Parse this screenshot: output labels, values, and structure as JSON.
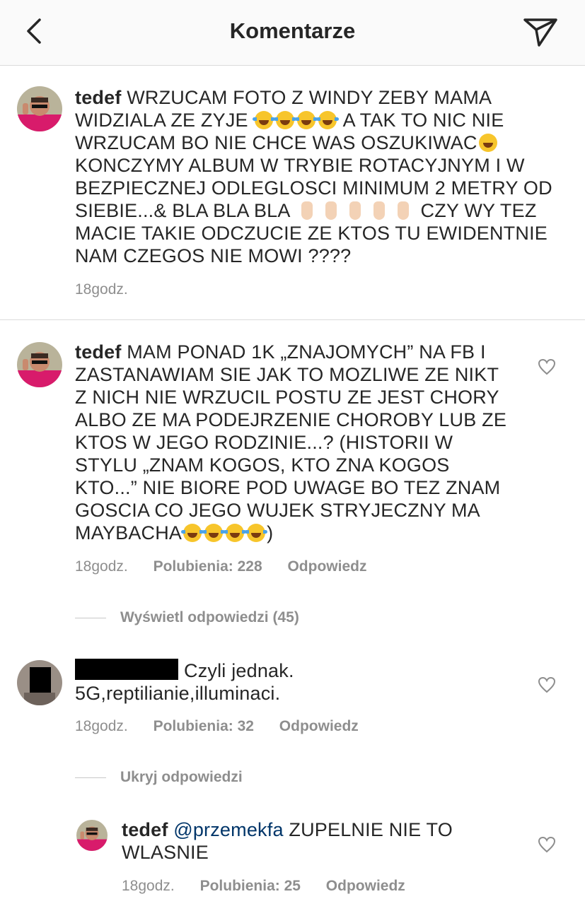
{
  "header": {
    "title": "Komentarze"
  },
  "comments": [
    {
      "user": "tedef",
      "lines": [
        "WRZUCAM FOTO Z WINDY ZEBY MAMA",
        "WIDZIALA ZE ZYJE",
        "A TAK TO NIC NIE",
        "WRZUCAM BO NIE CHCE WAS OSZUKIWAC",
        "KONCZYMY ALBUM W TRYBIE ROTACYJNYM I W",
        "BEZPIECZNEJ ODLEGLOSCI MINIMUM 2 METRY OD",
        "SIEBIE...& BLA BLA BLA",
        "CZY WY TEZ",
        "MACIE TAKIE ODCZUCIE ZE KTOS TU EWIDENTNIE",
        "NAM CZEGOS NIE MOWI ????"
      ],
      "time": "18godz."
    },
    {
      "user": "tedef",
      "lines": [
        "MAM PONAD 1K „ZNAJOMYCH” NA FB I",
        "ZASTANAWIAM SIE JAK TO MOZLIWE ZE NIKT",
        "Z NICH NIE WRZUCIL POSTU ZE JEST CHORY",
        "ALBO ZE MA PODEJRZENIE CHOROBY LUB ZE",
        "KTOS W JEGO RODZINIE...? (HISTORII W",
        "STYLU „ZNAM KOGOS, KTO ZNA KOGOS",
        "KTO...” NIE BIORE POD UWAGE BO TEZ ZNAM",
        "GOSCIA CO JEGO WUJEK STRYJECZNY MA",
        "MAYBACHA",
        ")"
      ],
      "time": "18godz.",
      "likes": "Polubienia: 228",
      "reply": "Odpowiedz",
      "view_replies": "Wyświetl odpowiedzi (45)"
    },
    {
      "lines": [
        "Czyli jednak.",
        "5G,reptilianie,illuminaci."
      ],
      "time": "18godz.",
      "likes": "Polubienia: 32",
      "reply": "Odpowiedz",
      "hide_replies": "Ukryj odpowiedzi"
    },
    {
      "user": "tedef",
      "mention": "@przemekfa",
      "lines": [
        "ZUPELNIE NIE TO",
        "WLASNIE"
      ],
      "time": "18godz.",
      "likes": "Polubienia: 25",
      "reply": "Odpowiedz"
    }
  ],
  "icons": {
    "back": "chevron-left-icon",
    "send": "paper-plane-icon",
    "like": "heart-outline-icon",
    "laugh": "face-with-tears-of-joy-emoji",
    "zany": "zany-face-emoji",
    "middle_finger": "middle-finger-emoji"
  },
  "colors": {
    "text": "#262626",
    "meta": "#8e8e8e",
    "mention": "#003569",
    "separator": "#dbdbdb"
  }
}
